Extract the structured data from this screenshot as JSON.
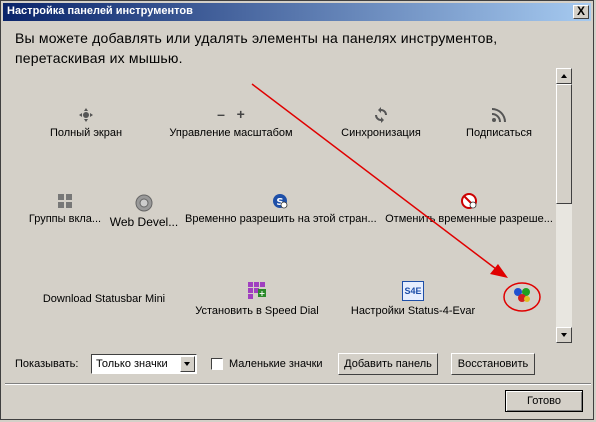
{
  "window": {
    "title": "Настройка панелей инструментов",
    "close_label": "X"
  },
  "instructions": "Вы можете добавлять или удалять элементы на панелях инструментов, перетаскивая их мышью.",
  "items": [
    {
      "label": "Полный экран",
      "icon": "fullscreen-icon"
    },
    {
      "label": "Управление масштабом",
      "icon": "zoom-icon",
      "zoom_out": "–",
      "zoom_in": "+"
    },
    {
      "label": "Синхронизация",
      "icon": "sync-icon"
    },
    {
      "label": "Подписаться",
      "icon": "rss-icon"
    },
    {
      "label": "Группы вкла...",
      "icon": "tab-groups-icon"
    },
    {
      "label": "Web Devel...",
      "icon": "gear-icon"
    },
    {
      "label": "Временно разрешить на этой стран...",
      "icon": "script-allow-icon"
    },
    {
      "label": "Отменить временные разреше...",
      "icon": "script-revoke-icon"
    },
    {
      "label": "Download Statusbar Mini",
      "icon": ""
    },
    {
      "label": "Установить в Speed Dial",
      "icon": "speed-dial-icon"
    },
    {
      "label": "Настройки Status-4-Evar",
      "icon": "s4e-icon",
      "icon_text": "S4E"
    },
    {
      "label": "",
      "icon": "colored-balls-icon"
    }
  ],
  "bottom": {
    "show_label": "Показывать:",
    "show_value": "Только значки",
    "small_icons_label": "Маленькие значки",
    "small_icons_checked": false,
    "add_panel_label": "Добавить панель",
    "restore_label": "Восстановить"
  },
  "done_label": "Готово",
  "colors": {
    "title_start": "#0a246a",
    "title_end": "#a6caf0",
    "annotation": "#e00000"
  }
}
